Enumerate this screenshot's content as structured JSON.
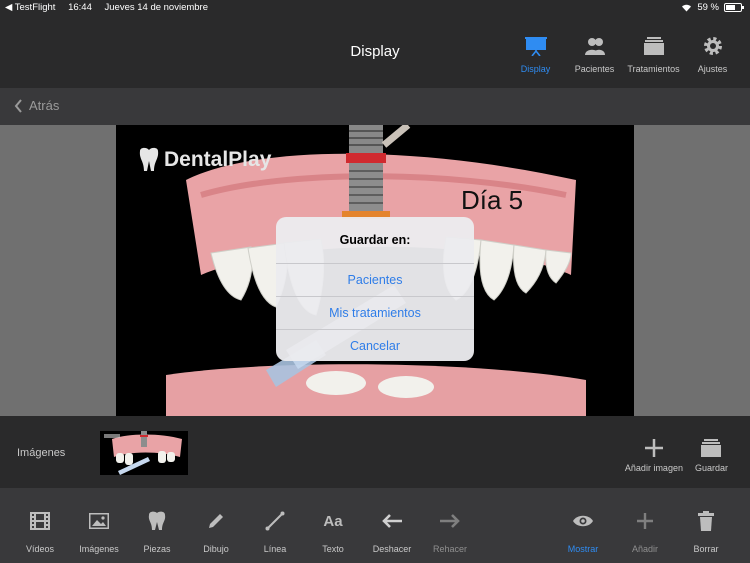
{
  "status_bar": {
    "app": "◀ TestFlight",
    "time": "16:44",
    "date": "Jueves 14 de noviembre",
    "battery": "59 %"
  },
  "nav": {
    "title": "Display",
    "tabs": [
      {
        "label": "Display",
        "icon": "presentation-icon",
        "active": true
      },
      {
        "label": "Pacientes",
        "icon": "patients-icon"
      },
      {
        "label": "Tratamientos",
        "icon": "treatments-icon"
      },
      {
        "label": "Ajustes",
        "icon": "gear-icon"
      }
    ]
  },
  "back": {
    "label": "Atrás"
  },
  "stage": {
    "logo_text": "DentalPlay",
    "day_label": "Día 5"
  },
  "dialog": {
    "title": "Guardar en:",
    "options": [
      "Pacientes",
      "Mis tratamientos",
      "Cancelar"
    ]
  },
  "images_bar": {
    "label": "Imágenes",
    "actions": [
      {
        "label": "Añadir imagen",
        "icon": "plus-icon"
      },
      {
        "label": "Guardar",
        "icon": "tray-icon"
      }
    ]
  },
  "toolbar": {
    "tools": [
      {
        "label": "Vídeos",
        "icon": "film-icon"
      },
      {
        "label": "Imágenes",
        "icon": "image-icon"
      },
      {
        "label": "Piezas",
        "icon": "tooth-icon"
      },
      {
        "label": "Dibujo",
        "icon": "pencil-icon"
      },
      {
        "label": "Línea",
        "icon": "line-icon"
      },
      {
        "label": "Texto",
        "icon": "text-icon"
      },
      {
        "label": "Deshacer",
        "icon": "arrow-left-icon"
      },
      {
        "label": "Rehacer",
        "icon": "arrow-right-icon"
      },
      {
        "label": "Mostrar",
        "icon": "eye-icon",
        "active": true
      },
      {
        "label": "Añadir",
        "icon": "plus-icon"
      },
      {
        "label": "Borrar",
        "icon": "trash-icon"
      }
    ]
  },
  "colors": {
    "accent": "#2f8cf2",
    "background": "#2a2a2b",
    "toolbar": "#39393b"
  }
}
